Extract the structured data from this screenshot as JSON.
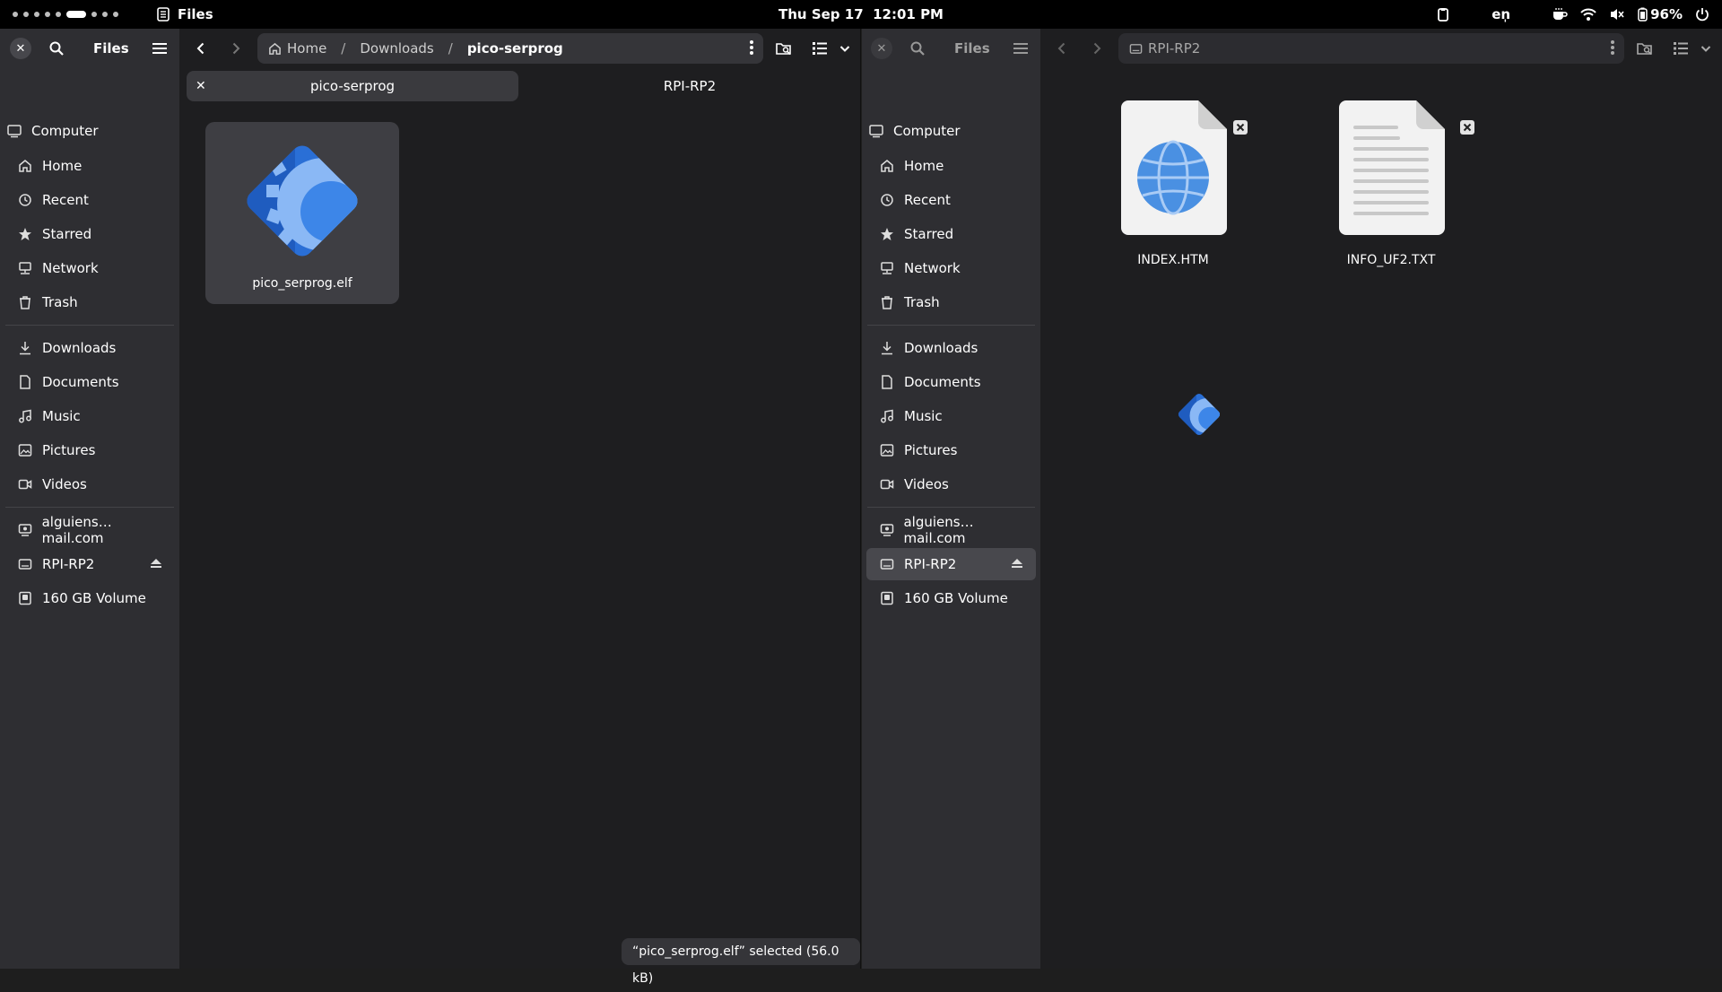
{
  "topbar": {
    "app_name": "Files",
    "date": "Thu Sep 17",
    "time": "12:01 PM",
    "keyboard_layout": "en̩",
    "battery": "96%"
  },
  "sidebar": {
    "title": "Files",
    "items": {
      "computer": "Computer",
      "home": "Home",
      "recent": "Recent",
      "starred": "Starred",
      "network": "Network",
      "trash": "Trash",
      "downloads": "Downloads",
      "documents": "Documents",
      "music": "Music",
      "pictures": "Pictures",
      "videos": "Videos",
      "account": "alguiens… mail.com",
      "rpi": "RPI-RP2",
      "volume": "160 GB Volume"
    }
  },
  "left_window": {
    "path": [
      "Home",
      "Downloads",
      "pico-serprog"
    ],
    "tabs": [
      "pico-serprog",
      "RPI-RP2"
    ],
    "files": [
      {
        "name": "pico_serprog.elf",
        "icon": "executable-gear-icon"
      }
    ],
    "status": "“pico_serprog.elf” selected  (56.0 kB)"
  },
  "right_window": {
    "path": "RPI-RP2",
    "files": [
      {
        "name": "INDEX.HTM",
        "icon": "html-globe-icon"
      },
      {
        "name": "INFO_UF2.TXT",
        "icon": "text-document-icon"
      }
    ]
  },
  "colors": {
    "accent_blue": "#3584e4",
    "sidebar_bg": "#2e2e32",
    "main_bg": "#1e1e20"
  }
}
